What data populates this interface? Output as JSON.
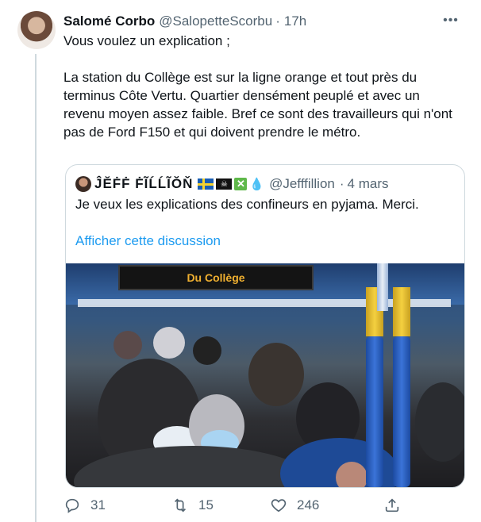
{
  "tweet": {
    "author_name": "Salomé Corbo",
    "author_handle": "@SalopetteScorbu",
    "separator": "·",
    "time": "17h",
    "more_icon": "more-horizontal-icon",
    "text_line1": "Vous voulez un explication  ;",
    "text_para2": "La station du Collège est sur la ligne orange et tout près du terminus Côte Vertu. Quartier densément peuplé et avec un revenu moyen assez faible. Bref ce sont des travailleurs qui n'ont pas de Ford F150 et qui doivent prendre le métro."
  },
  "quoted": {
    "author_name": "ĴĔḞḞ ḞĨĹĹĨŎŇ",
    "author_handle": "@Jefffillion",
    "separator": "·",
    "time": "4 mars",
    "emojis": [
      "sweden-flag-icon",
      "pirate-flag-icon",
      "cross-mark-button-icon",
      "droplet-icon"
    ],
    "text": "Je veux les explications des confineurs en pyjama. Merci.",
    "link": "Afficher cette discussion",
    "photo_sign": "Du Collège"
  },
  "actions": {
    "replies": "31",
    "retweets": "15",
    "likes": "246"
  },
  "colors": {
    "text": "#0f1419",
    "secondary": "#536471",
    "link": "#1d9bf0",
    "border": "#cfd9de"
  }
}
